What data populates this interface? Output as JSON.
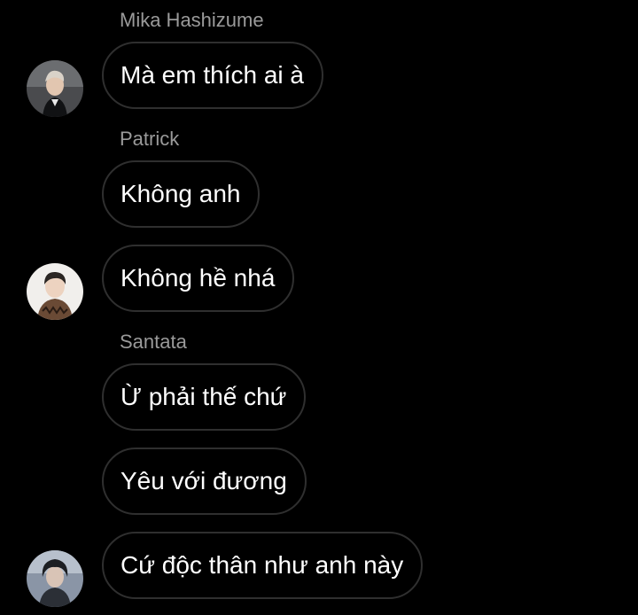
{
  "colors": {
    "background": "#000000",
    "bubble_border": "#2f2f2f",
    "message_text": "#ffffff",
    "sender_name_text": "#9a9a9a"
  },
  "groups": [
    {
      "sender": "Mika Hashizume",
      "avatar_icon": "user-avatar-photo",
      "messages": [
        "Mà em thích ai à"
      ]
    },
    {
      "sender": "Patrick",
      "avatar_icon": "user-avatar-photo",
      "messages": [
        "Không anh",
        "Không hề nhá"
      ]
    },
    {
      "sender": "Santata",
      "avatar_icon": "user-avatar-photo",
      "messages": [
        "Ừ phải thế chứ",
        "Yêu với đương",
        "Cứ độc thân như anh này"
      ]
    }
  ]
}
